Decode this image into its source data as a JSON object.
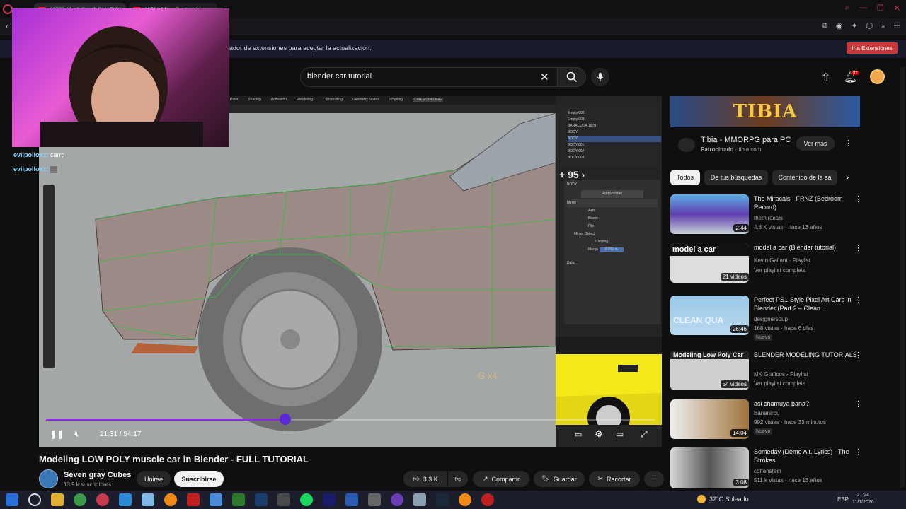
{
  "browser": {
    "tabs": [
      {
        "title": "(479) Modeling LOW POL"
      },
      {
        "title": "(479) Mira Bart ahí hay un"
      }
    ],
    "infobar_text": "ador de extensiones para aceptar la actualización.",
    "infobar_button": "Ir a Extensiones"
  },
  "header": {
    "search_value": "blender car tutorial",
    "notification_count": "9+"
  },
  "stream_overlay": {
    "chat": [
      {
        "user": "evilpolloxx:",
        "message": "carro"
      },
      {
        "user": "evilpolloxx:",
        "message": ""
      }
    ]
  },
  "player": {
    "time": "21:31 / 54:17",
    "progress": 0.39,
    "end_screen_more": "+ 95",
    "blender_tabs": [
      "Paint",
      "Shading",
      "Animation",
      "Rendering",
      "Compositing",
      "Geometry Nodes",
      "Scripting",
      "CAR MODELING"
    ],
    "blender_outliner": [
      "Empty.002",
      "Empty.003",
      "BARACUDA 1970",
      "BODY",
      "BODY",
      "BODY.001",
      "BODY.002",
      "BODY.003"
    ],
    "blender_props": {
      "header": "BODY",
      "modifier_btn": "Add Modifier",
      "modifier": "Mirror",
      "axis": "Axis",
      "bisect": "Bisect",
      "flip": "Flip",
      "mirror_object": "Mirror Object",
      "clipping": "Clipping",
      "merge": "Merge",
      "merge_value": "0.001 m",
      "data": "Data"
    },
    "overlay_text": "G x4"
  },
  "video": {
    "title": "Modeling LOW POLY muscle car in Blender - FULL TUTORIAL",
    "channel": "Seven gray Cubes",
    "subscribers": "13.9 k suscriptores",
    "join_label": "Unirse",
    "subscribe_label": "Suscribirse",
    "likes": "3.3 K",
    "share_label": "Compartir",
    "save_label": "Guardar",
    "clip_label": "Recortar"
  },
  "sidebar": {
    "ad": {
      "banner_text": "TIBIA",
      "title": "Tibia - MMORPG para PC",
      "sponsor_label": "Patrocinado",
      "sponsor_domain": "tibia.com",
      "button": "Ver más"
    },
    "chips": [
      "Todos",
      "De tus búsquedas",
      "Contenido de la sa"
    ],
    "recommendations": [
      {
        "title": "The Miracals - FRNZ (Bedroom Record)",
        "channel": "themiracals",
        "meta": "4.8 K vistas · hace 13 años",
        "badge": "2:44",
        "thumb_text": "",
        "nuevo": ""
      },
      {
        "title": "model a car (Blender tutorial)",
        "channel": "Kevin Gallant · Playlist",
        "meta": "Ver playlist completa",
        "badge": "21 videos",
        "thumb_text": "model a car",
        "nuevo": ""
      },
      {
        "title": "Perfect PS1-Style Pixel Art Cars in Blender (Part 2 – Clean ...",
        "channel": "designersoup",
        "meta": "168 vistas · hace 6 días",
        "badge": "26:46",
        "thumb_text": "CLEAN QUA",
        "nuevo": "Nuevo"
      },
      {
        "title": "BLENDER MODELING TUTORIALS",
        "channel": "MK Gráficos · Playlist",
        "meta": "Ver playlist completa",
        "badge": "54 videos",
        "thumb_text": "Modeling Low Poly Car",
        "nuevo": ""
      },
      {
        "title": "asi chamuya bana?",
        "channel": "Bananirou",
        "meta": "992 vistas · hace 33 minutos",
        "badge": "14:04",
        "thumb_text": "",
        "nuevo": "Nuevo"
      },
      {
        "title": "Someday (Demo Alt. Lyrics) - The Strokes",
        "channel": "coffenstein",
        "meta": "511 k vistas · hace 13 años",
        "badge": "3:08",
        "thumb_text": "",
        "nuevo": ""
      }
    ]
  },
  "taskbar": {
    "weather": "32°C  Soleado",
    "language": "ESP",
    "time": "21:24",
    "date": "11/1/2026"
  },
  "colors": {
    "accent": "#ff0033",
    "progress": "#8a2be2",
    "background": "#0f0f0f"
  }
}
